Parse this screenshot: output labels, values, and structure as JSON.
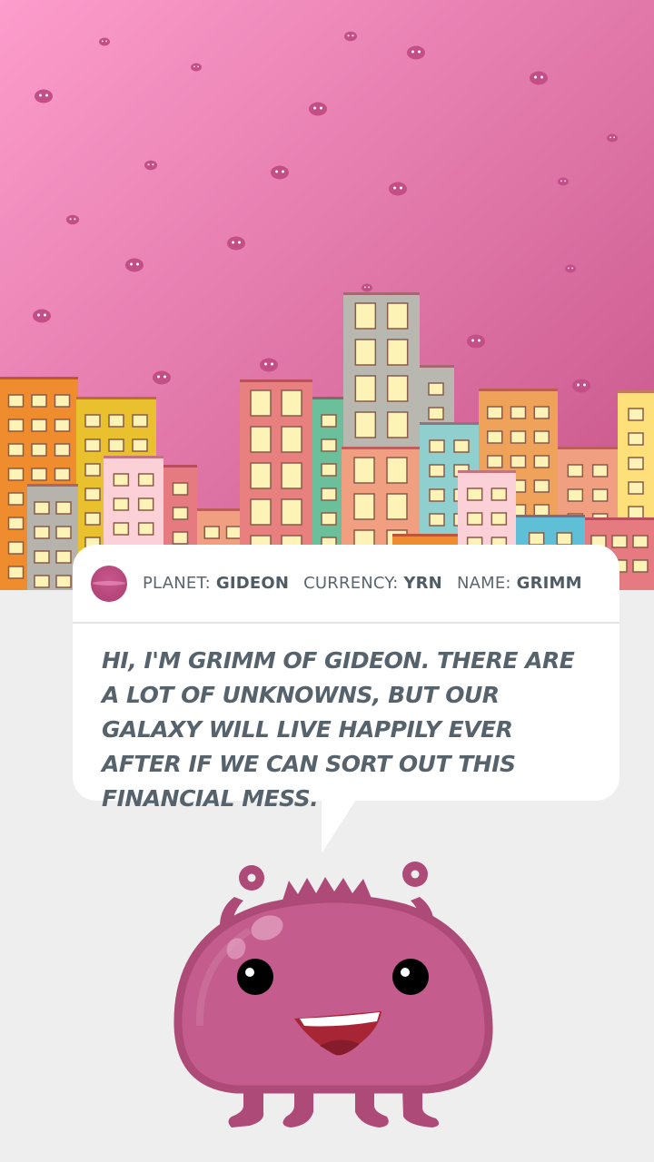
{
  "info": {
    "planet_label": "PLANET:",
    "planet_value": "GIDEON",
    "currency_label": "CURRENCY:",
    "currency_value": "YRN",
    "name_label": "NAME:",
    "name_value": "GRIMM"
  },
  "dialogue": {
    "text": "Hi, I'm Grimm of Gideon. There are a lot of unknowns, but our galaxy will live happily ever after if we can sort out this financial mess."
  },
  "colors": {
    "sky_top": "#fd9dcc",
    "sky_bottom": "#c65388",
    "monster_body": "#c45c8d",
    "monster_outline": "#ae4a77",
    "text": "#56636d"
  }
}
